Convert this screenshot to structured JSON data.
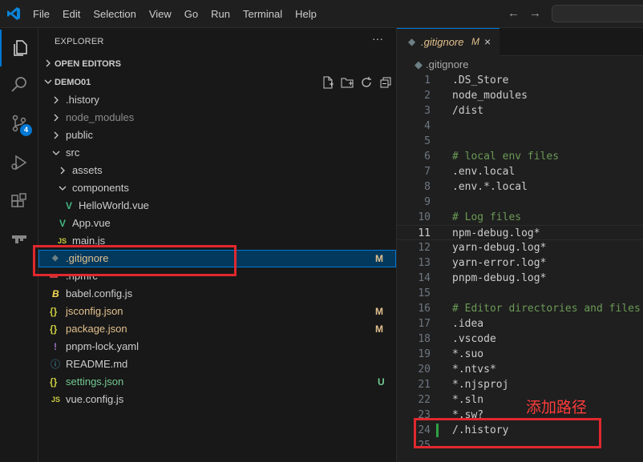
{
  "menu": [
    "File",
    "Edit",
    "Selection",
    "View",
    "Go",
    "Run",
    "Terminal",
    "Help"
  ],
  "activity_bar": {
    "source_control_badge": "4"
  },
  "sidebar": {
    "title": "EXPLORER",
    "more": "···",
    "open_editors": "OPEN EDITORS",
    "project": "DEMO01",
    "tree": [
      {
        "name": ".history",
        "color": "#cccccc",
        "icon": "",
        "icon_color": "",
        "status": ""
      },
      {
        "name": "node_modules",
        "color": "#8c8c8c",
        "icon": "",
        "icon_color": "",
        "status": ""
      },
      {
        "name": "public",
        "color": "#cccccc",
        "icon": "",
        "icon_color": "",
        "status": ""
      },
      {
        "name": "src",
        "color": "#cccccc",
        "icon": "",
        "icon_color": "",
        "status": ""
      },
      {
        "name": "assets",
        "color": "#cccccc",
        "icon": "",
        "icon_color": "",
        "status": ""
      },
      {
        "name": "components",
        "color": "#cccccc",
        "icon": "",
        "icon_color": "",
        "status": ""
      },
      {
        "name": "HelloWorld.vue",
        "color": "#cccccc",
        "icon": "V",
        "icon_color": "#41b883",
        "status": ""
      },
      {
        "name": "App.vue",
        "color": "#cccccc",
        "icon": "V",
        "icon_color": "#41b883",
        "status": ""
      },
      {
        "name": "main.js",
        "color": "#cccccc",
        "icon": "JS",
        "icon_color": "#cbcb41",
        "status": ""
      },
      {
        "name": ".gitignore",
        "color": "#e2c08d",
        "icon": "◆",
        "icon_color": "#6d8086",
        "status": "M"
      },
      {
        "name": ".npmrc",
        "color": "#cccccc",
        "icon": "▬",
        "icon_color": "#c23b3b",
        "status": ""
      },
      {
        "name": "babel.config.js",
        "color": "#cccccc",
        "icon": "B",
        "icon_color": "#f5da55",
        "status": ""
      },
      {
        "name": "jsconfig.json",
        "color": "#e2c08d",
        "icon": "{}",
        "icon_color": "#cbcb41",
        "status": "M"
      },
      {
        "name": "package.json",
        "color": "#e2c08d",
        "icon": "{}",
        "icon_color": "#cbcb41",
        "status": "M"
      },
      {
        "name": "pnpm-lock.yaml",
        "color": "#cccccc",
        "icon": "!",
        "icon_color": "#a074c4",
        "status": ""
      },
      {
        "name": "README.md",
        "color": "#cccccc",
        "icon": "ⓘ",
        "icon_color": "#519aba",
        "status": ""
      },
      {
        "name": "settings.json",
        "color": "#73c991",
        "icon": "{}",
        "icon_color": "#cbcb41",
        "status": "U"
      },
      {
        "name": "vue.config.js",
        "color": "#cccccc",
        "icon": "JS",
        "icon_color": "#cbcb41",
        "status": ""
      }
    ]
  },
  "editor": {
    "tab": {
      "name": ".gitignore",
      "modified": "M",
      "close": "×"
    },
    "breadcrumb": ".gitignore",
    "lines": [
      {
        "n": "1",
        "text": ".DS_Store",
        "comment": false
      },
      {
        "n": "2",
        "text": "node_modules",
        "comment": false
      },
      {
        "n": "3",
        "text": "/dist",
        "comment": false
      },
      {
        "n": "4",
        "text": "",
        "comment": false
      },
      {
        "n": "5",
        "text": "",
        "comment": false
      },
      {
        "n": "6",
        "text": "# local env files",
        "comment": true
      },
      {
        "n": "7",
        "text": ".env.local",
        "comment": false
      },
      {
        "n": "8",
        "text": ".env.*.local",
        "comment": false
      },
      {
        "n": "9",
        "text": "",
        "comment": false
      },
      {
        "n": "10",
        "text": "# Log files",
        "comment": true
      },
      {
        "n": "11",
        "text": "npm-debug.log*",
        "comment": false
      },
      {
        "n": "12",
        "text": "yarn-debug.log*",
        "comment": false
      },
      {
        "n": "13",
        "text": "yarn-error.log*",
        "comment": false
      },
      {
        "n": "14",
        "text": "pnpm-debug.log*",
        "comment": false
      },
      {
        "n": "15",
        "text": "",
        "comment": false
      },
      {
        "n": "16",
        "text": "# Editor directories and files",
        "comment": true
      },
      {
        "n": "17",
        "text": ".idea",
        "comment": false
      },
      {
        "n": "18",
        "text": ".vscode",
        "comment": false
      },
      {
        "n": "19",
        "text": "*.suo",
        "comment": false
      },
      {
        "n": "20",
        "text": "*.ntvs*",
        "comment": false
      },
      {
        "n": "21",
        "text": "*.njsproj",
        "comment": false
      },
      {
        "n": "22",
        "text": "*.sln",
        "comment": false
      },
      {
        "n": "23",
        "text": "*.sw?",
        "comment": false
      },
      {
        "n": "24",
        "text": "/.history",
        "comment": false
      },
      {
        "n": "25",
        "text": "",
        "comment": false
      }
    ]
  },
  "annotation": {
    "text": "添加路径"
  },
  "colors": {
    "accent": "#0078d4",
    "annotation": "#e0282e"
  }
}
